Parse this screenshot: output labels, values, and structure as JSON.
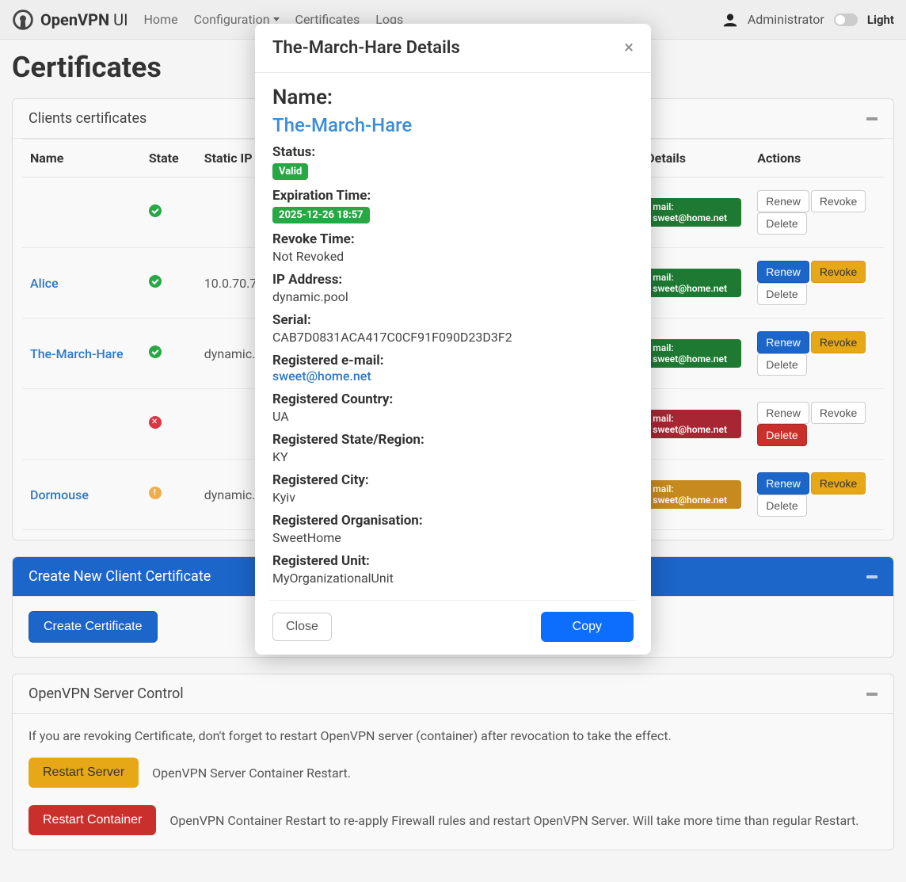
{
  "brand": {
    "name": "OpenVPN",
    "suffix": "UI"
  },
  "nav": {
    "items": [
      {
        "label": "Home"
      },
      {
        "label": "Configuration"
      },
      {
        "label": "Certificates"
      },
      {
        "label": "Logs"
      }
    ],
    "user": "Administrator",
    "theme": "Light"
  },
  "page": {
    "title": "Certificates"
  },
  "panels": {
    "clients": {
      "title": "Clients certificates",
      "columns": [
        "Name",
        "State",
        "Static IP",
        "Details",
        "Actions"
      ],
      "rows": [
        {
          "name": "",
          "name_link": false,
          "state": "valid",
          "ip": "",
          "detail_badge": "mail: sweet@home.net",
          "detail_style": "green",
          "actions": [
            {
              "label": "Renew",
              "style": "plain"
            },
            {
              "label": "Revoke",
              "style": "plain"
            },
            {
              "label": "Delete",
              "style": "plain"
            }
          ]
        },
        {
          "name": "Alice",
          "name_link": true,
          "state": "valid",
          "ip": "10.0.70.7",
          "detail_badge": "mail: sweet@home.net",
          "detail_style": "green",
          "actions": [
            {
              "label": "Renew",
              "style": "primary"
            },
            {
              "label": "Revoke",
              "style": "warning"
            },
            {
              "label": "Delete",
              "style": "plain"
            }
          ]
        },
        {
          "name": "The-March-Hare",
          "name_link": true,
          "state": "valid",
          "ip": "dynamic.pool",
          "detail_badge": "mail: sweet@home.net",
          "detail_style": "green",
          "actions": [
            {
              "label": "Renew",
              "style": "primary"
            },
            {
              "label": "Revoke",
              "style": "warning"
            },
            {
              "label": "Delete",
              "style": "plain"
            }
          ]
        },
        {
          "name": "",
          "name_link": false,
          "state": "revoked",
          "ip": "",
          "detail_badge": "mail: sweet@home.net",
          "detail_style": "red",
          "actions": [
            {
              "label": "Renew",
              "style": "plain"
            },
            {
              "label": "Revoke",
              "style": "plain"
            },
            {
              "label": "Delete",
              "style": "danger"
            }
          ]
        },
        {
          "name": "Dormouse",
          "name_link": true,
          "state": "expiring",
          "ip": "dynamic.pool",
          "detail_badge": "mail: sweet@home.net",
          "detail_style": "orange",
          "actions": [
            {
              "label": "Renew",
              "style": "primary"
            },
            {
              "label": "Revoke",
              "style": "warning"
            },
            {
              "label": "Delete",
              "style": "plain"
            }
          ]
        }
      ]
    },
    "create": {
      "title": "Create New Client Certificate",
      "button": "Create Certificate"
    },
    "server": {
      "title": "OpenVPN Server Control",
      "note": "If you are revoking Certificate, don't forget to restart OpenVPN server (container) after revocation to take the effect.",
      "restart_server": "Restart Server",
      "restart_server_desc": "OpenVPN Server Container Restart.",
      "restart_container": "Restart Container",
      "restart_container_desc": "OpenVPN Container Restart to re-apply Firewall rules and restart OpenVPN Server. Will take more time than regular Restart."
    }
  },
  "modal": {
    "title": "The-March-Hare Details",
    "name_label": "Name:",
    "name_value": "The-March-Hare",
    "fields": [
      {
        "label": "Status:",
        "type": "badge",
        "value": "Valid",
        "badge": "sb-green"
      },
      {
        "label": "Expiration Time:",
        "type": "badge",
        "value": "2025-12-26 18:57",
        "badge": "sb-green"
      },
      {
        "label": "Revoke Time:",
        "type": "text",
        "value": "Not Revoked"
      },
      {
        "label": "IP Address:",
        "type": "text",
        "value": "dynamic.pool"
      },
      {
        "label": "Serial:",
        "type": "text",
        "value": "CAB7D0831ACA417C0CF91F090D23D3F2"
      },
      {
        "label": "Registered e-mail:",
        "type": "link",
        "value": "sweet@home.net"
      },
      {
        "label": "Registered Country:",
        "type": "text",
        "value": "UA"
      },
      {
        "label": "Registered State/Region:",
        "type": "text",
        "value": "KY"
      },
      {
        "label": "Registered City:",
        "type": "text",
        "value": "Kyiv"
      },
      {
        "label": "Registered Organisation:",
        "type": "text",
        "value": "SweetHome"
      },
      {
        "label": "Registered Unit:",
        "type": "text",
        "value": "MyOrganizationalUnit"
      }
    ],
    "close": "Close",
    "copy": "Copy"
  }
}
